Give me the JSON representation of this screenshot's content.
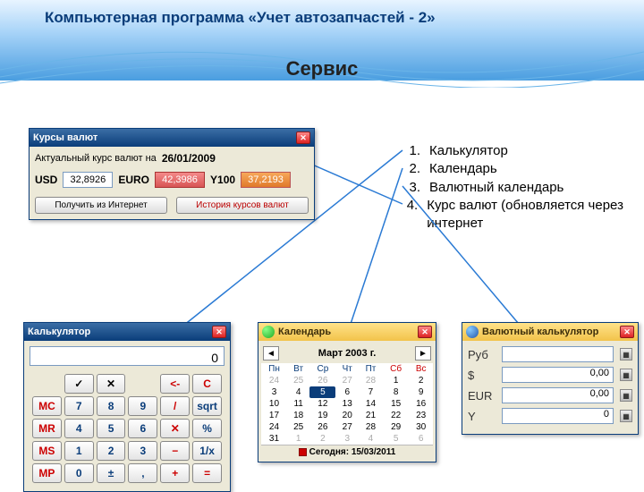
{
  "page": {
    "title": "Компьютерная программа «Учет автозапчастей - 2»",
    "subtitle": "Сервис"
  },
  "bullets": [
    "Калькулятор",
    "Календарь",
    "Валютный календарь",
    "Курс валют (обновляется через интернет"
  ],
  "cur": {
    "title": "Курсы валют",
    "actual_label": "Актуальный курс валют на",
    "date": "26/01/2009",
    "items": [
      {
        "code": "USD",
        "rate": "32,8926"
      },
      {
        "code": "EURO",
        "rate": "42,3986"
      },
      {
        "code": "Y100",
        "rate": "37,2193"
      }
    ],
    "btn_get": "Получить из Интернет",
    "btn_hist": "История курсов валют"
  },
  "calc": {
    "title": "Калькулятор",
    "display": "0",
    "rows": [
      [
        {
          "t": "",
          "c": "blk"
        },
        {
          "t": "✓",
          "c": "blk"
        },
        {
          "t": "✕",
          "c": "blk"
        },
        {
          "t": "",
          "c": "blk"
        },
        {
          "t": "<-",
          "c": "red"
        },
        {
          "t": "C",
          "c": "red"
        }
      ],
      [
        {
          "t": "MC",
          "c": "red"
        },
        {
          "t": "7",
          "c": ""
        },
        {
          "t": "8",
          "c": ""
        },
        {
          "t": "9",
          "c": ""
        },
        {
          "t": "/",
          "c": "red"
        },
        {
          "t": "sqrt",
          "c": ""
        }
      ],
      [
        {
          "t": "MR",
          "c": "red"
        },
        {
          "t": "4",
          "c": ""
        },
        {
          "t": "5",
          "c": ""
        },
        {
          "t": "6",
          "c": ""
        },
        {
          "t": "✕",
          "c": "red"
        },
        {
          "t": "%",
          "c": ""
        }
      ],
      [
        {
          "t": "MS",
          "c": "red"
        },
        {
          "t": "1",
          "c": ""
        },
        {
          "t": "2",
          "c": ""
        },
        {
          "t": "3",
          "c": ""
        },
        {
          "t": "−",
          "c": "red"
        },
        {
          "t": "1/x",
          "c": ""
        }
      ],
      [
        {
          "t": "MP",
          "c": "red"
        },
        {
          "t": "0",
          "c": ""
        },
        {
          "t": "±",
          "c": ""
        },
        {
          "t": ",",
          "c": ""
        },
        {
          "t": "+",
          "c": "red"
        },
        {
          "t": "=",
          "c": "red"
        }
      ]
    ]
  },
  "cal": {
    "title": "Календарь",
    "month": "Март 2003 г.",
    "dow": [
      "Пн",
      "Вт",
      "Ср",
      "Чт",
      "Пт",
      "Сб",
      "Вс"
    ],
    "weeks": [
      [
        {
          "d": 24,
          "g": true
        },
        {
          "d": 25,
          "g": true
        },
        {
          "d": 26,
          "g": true
        },
        {
          "d": 27,
          "g": true
        },
        {
          "d": 28,
          "g": true
        },
        {
          "d": 1
        },
        {
          "d": 2
        }
      ],
      [
        {
          "d": 3
        },
        {
          "d": 4
        },
        {
          "d": 5,
          "t": true
        },
        {
          "d": 6
        },
        {
          "d": 7
        },
        {
          "d": 8
        },
        {
          "d": 9
        }
      ],
      [
        {
          "d": 10
        },
        {
          "d": 11
        },
        {
          "d": 12
        },
        {
          "d": 13
        },
        {
          "d": 14
        },
        {
          "d": 15
        },
        {
          "d": 16
        }
      ],
      [
        {
          "d": 17
        },
        {
          "d": 18
        },
        {
          "d": 19
        },
        {
          "d": 20
        },
        {
          "d": 21
        },
        {
          "d": 22
        },
        {
          "d": 23
        }
      ],
      [
        {
          "d": 24
        },
        {
          "d": 25
        },
        {
          "d": 26
        },
        {
          "d": 27
        },
        {
          "d": 28
        },
        {
          "d": 29
        },
        {
          "d": 30
        }
      ],
      [
        {
          "d": 31
        },
        {
          "d": 1,
          "g": true
        },
        {
          "d": 2,
          "g": true
        },
        {
          "d": 3,
          "g": true
        },
        {
          "d": 4,
          "g": true
        },
        {
          "d": 5,
          "g": true
        },
        {
          "d": 6,
          "g": true
        }
      ]
    ],
    "today_label": "Сегодня:",
    "today": "15/03/2011"
  },
  "ccalc": {
    "title": "Валютный калькулятор",
    "rows": [
      {
        "label": "Руб",
        "value": ""
      },
      {
        "label": "$",
        "value": "0,00"
      },
      {
        "label": "EUR",
        "value": "0,00"
      },
      {
        "label": "Y",
        "value": "0"
      }
    ]
  }
}
